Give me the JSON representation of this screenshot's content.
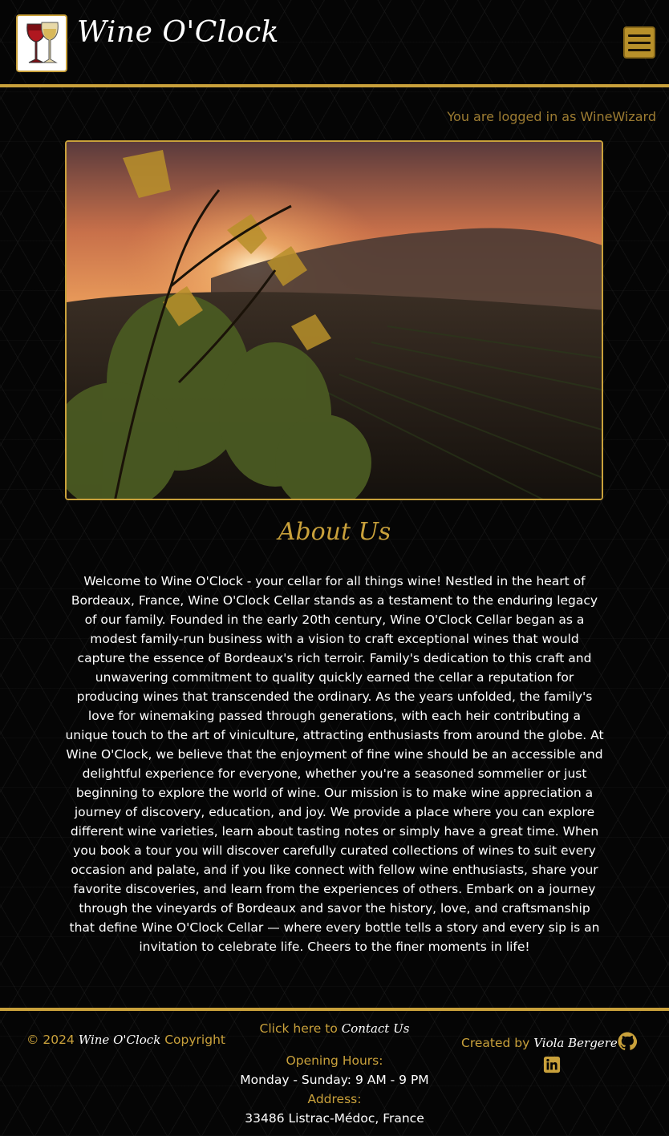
{
  "header": {
    "brand": "Wine O'Clock",
    "menu_icon": "hamburger-menu-icon",
    "logo_icon": "wine-glasses-logo"
  },
  "login_status": "You are logged in as WineWizard",
  "about": {
    "title": "About Us",
    "body": "Welcome to Wine O'Clock - your cellar for all things wine! Nestled in the heart of Bordeaux, France, Wine O'Clock Cellar stands as a testament to the enduring legacy of our family. Founded in the early 20th century, Wine O'Clock Cellar began as a modest family-run business with a vision to craft exceptional wines that would capture the essence of Bordeaux's rich terroir. Family's dedication to this craft and unwavering commitment to quality quickly earned the cellar a reputation for producing wines that transcended the ordinary. As the years unfolded, the family's love for winemaking passed through generations, with each heir contributing a unique touch to the art of viniculture, attracting enthusiasts from around the globe. At Wine O'Clock, we believe that the enjoyment of fine wine should be an accessible and delightful experience for everyone, whether you're a seasoned sommelier or just beginning to explore the world of wine. Our mission is to make wine appreciation a journey of discovery, education, and joy. We provide a place where you can explore different wine varieties, learn about tasting notes or simply have a great time. When you book a tour you will discover carefully curated collections of wines to suit every occasion and palate, and if you like connect with fellow wine enthusiasts, share your favorite discoveries, and learn from the experiences of others. Embark on a journey through the vineyards of Bordeaux and savor the history, love, and craftsmanship that define Wine O'Clock Cellar — where every bottle tells a story and every sip is an invitation to celebrate life. Cheers to the finer moments in life!"
  },
  "footer": {
    "copyright_prefix": "© 2024",
    "copyright_brand": "Wine O'Clock",
    "copyright_suffix": "Copyright",
    "contact_prefix": "Click here to",
    "contact_link": "Contact Us",
    "hours_label": "Opening Hours:",
    "hours_value": "Monday - Sunday: 9 AM - 9 PM",
    "address_label": "Address:",
    "address_value": "33486 Listrac-Médoc, France",
    "created_prefix": "Created by",
    "created_name": "Viola Bergere",
    "github_icon": "github-icon",
    "linkedin_icon": "linkedin-icon"
  },
  "colors": {
    "gold": "#c9a13b",
    "background": "#050505",
    "text": "#ffffff"
  }
}
